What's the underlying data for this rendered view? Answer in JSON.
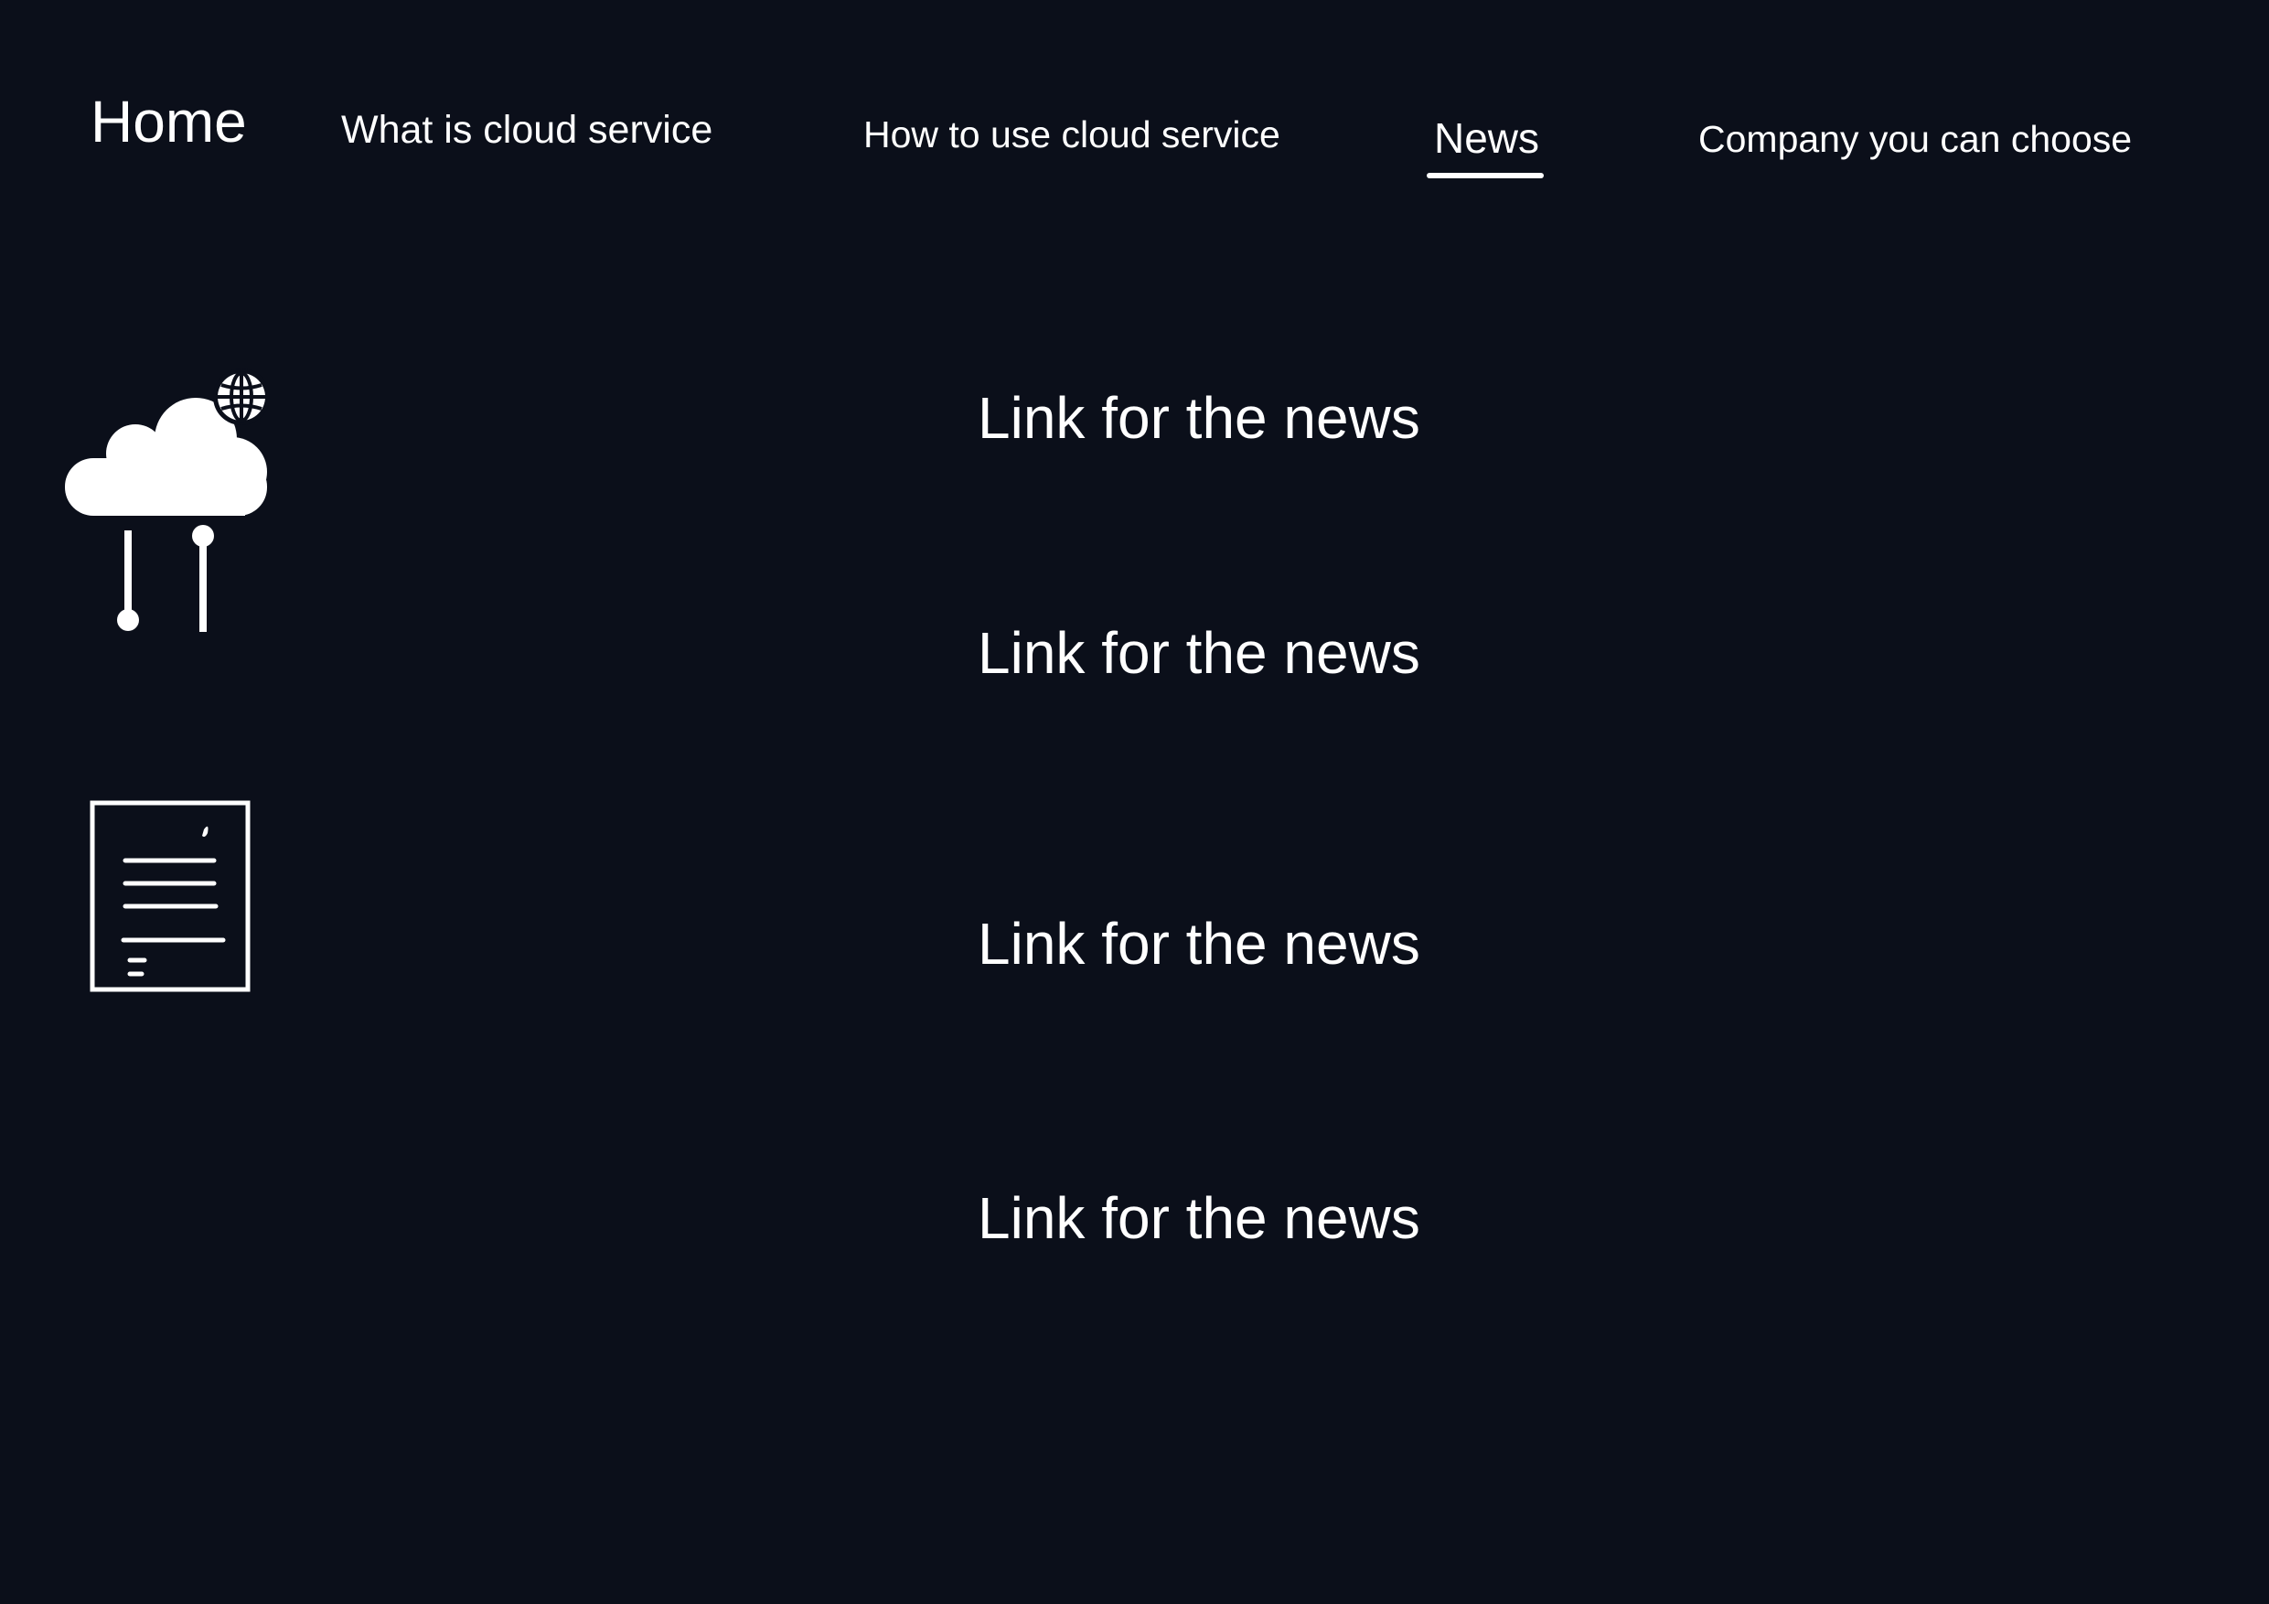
{
  "nav": {
    "home": "Home",
    "items": [
      {
        "label": "What is cloud service"
      },
      {
        "label": "How to use cloud service"
      },
      {
        "label": "News",
        "active": true
      },
      {
        "label": "Company you can choose"
      }
    ]
  },
  "news": {
    "links": [
      {
        "label": "Link for the news"
      },
      {
        "label": "Link for the news"
      },
      {
        "label": "Link for the news"
      },
      {
        "label": "Link for the news"
      }
    ]
  },
  "icons": {
    "cloud": "cloud-network-icon",
    "globe": "globe-icon",
    "document": "document-icon"
  },
  "colors": {
    "background": "#0b0f1a",
    "foreground": "#ffffff"
  }
}
